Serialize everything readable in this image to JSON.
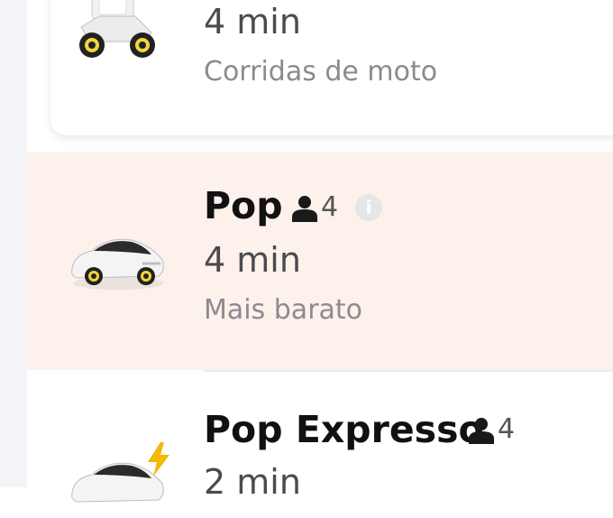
{
  "ride_options": [
    {
      "name": "",
      "capacity": "",
      "eta": "4 min",
      "description": "Corridas de moto",
      "icon": "motorcycle-icon"
    },
    {
      "name": "Pop",
      "capacity": "4",
      "eta": "4 min",
      "description": "Mais barato",
      "icon": "car-icon",
      "selected": true
    },
    {
      "name": "Pop Expresso",
      "capacity": "4",
      "eta": "2 min",
      "description": "",
      "icon": "electric-car-icon"
    }
  ],
  "info_icon": {
    "glyph": "i"
  },
  "colors": {
    "selected_bg": "#fdf1eb",
    "bolt": "#f5b800",
    "text_primary": "#111111",
    "text_secondary": "#8b8b90"
  }
}
